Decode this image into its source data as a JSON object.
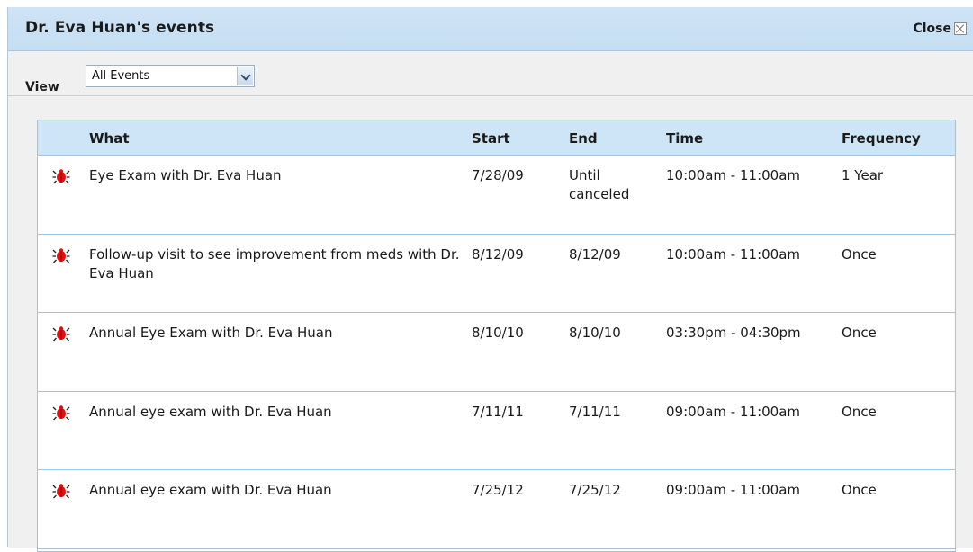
{
  "dialog": {
    "title": "Dr. Eva Huan's events",
    "close_label": "Close"
  },
  "view": {
    "label": "View",
    "selected": "All Events"
  },
  "table": {
    "headers": {
      "what": "What",
      "start": "Start",
      "end": "End",
      "time": "Time",
      "frequency": "Frequency"
    },
    "rows": [
      {
        "what": "Eye Exam with Dr. Eva Huan",
        "start": "7/28/09",
        "end": "Until canceled",
        "time": "10:00am - 11:00am",
        "frequency": "1 Year",
        "icon": "red-bug-icon"
      },
      {
        "what": "Follow-up visit to see improvement from meds with Dr. Eva Huan",
        "start": "8/12/09",
        "end": "8/12/09",
        "time": "10:00am - 11:00am",
        "frequency": "Once",
        "icon": "red-bug-icon"
      },
      {
        "what": "Annual Eye Exam with Dr. Eva Huan",
        "start": "8/10/10",
        "end": "8/10/10",
        "time": "03:30pm - 04:30pm",
        "frequency": "Once",
        "icon": "red-bug-icon"
      },
      {
        "what": "Annual eye exam with Dr. Eva Huan",
        "start": "7/11/11",
        "end": "7/11/11",
        "time": "09:00am - 11:00am",
        "frequency": "Once",
        "icon": "red-bug-icon"
      },
      {
        "what": "Annual eye exam with Dr. Eva Huan",
        "start": "7/25/12",
        "end": "7/25/12",
        "time": "09:00am - 11:00am",
        "frequency": "Once",
        "icon": "red-bug-icon"
      }
    ]
  },
  "colors": {
    "header_bg": "#cde5f6",
    "border": "#9fc3e0",
    "icon_red": "#e01010"
  }
}
